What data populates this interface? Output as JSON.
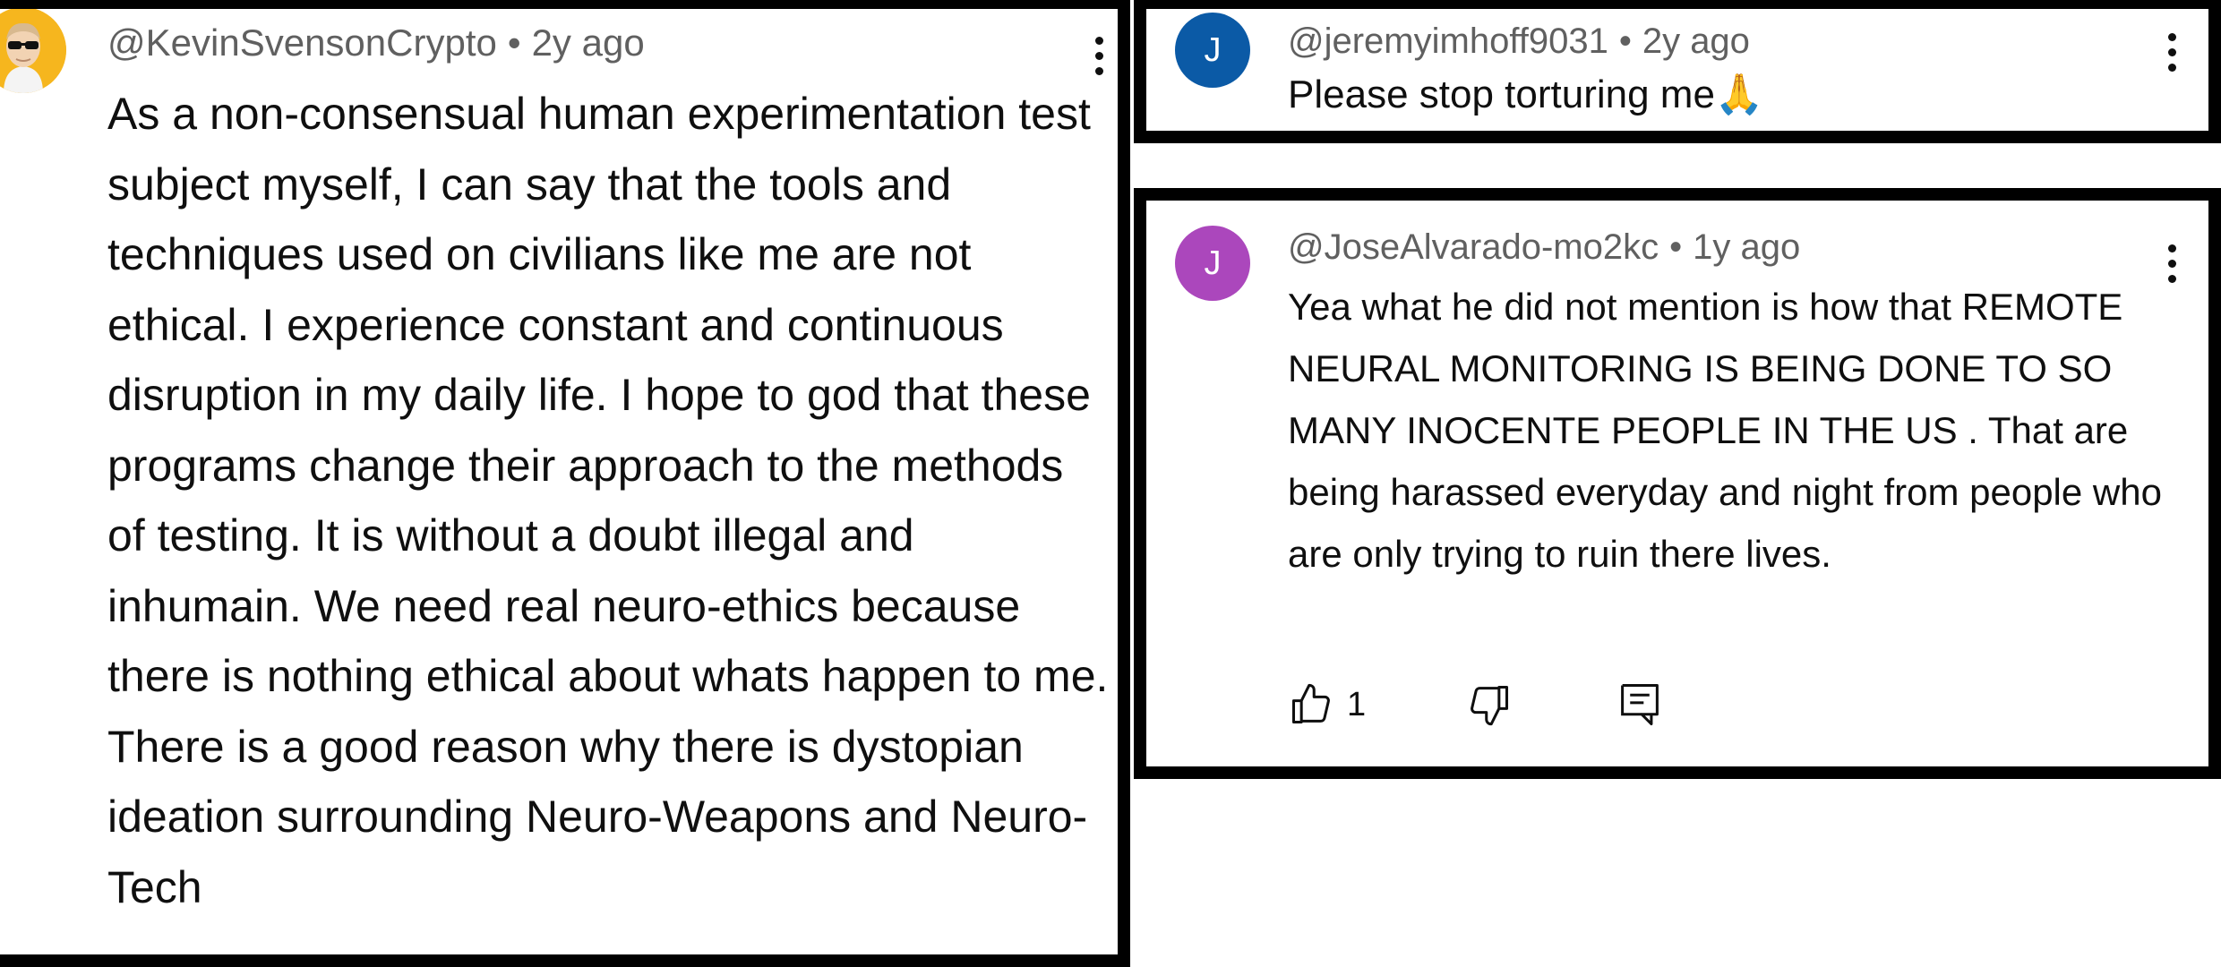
{
  "comments": [
    {
      "handle": "@KevinSvensonCrypto",
      "separator": "•",
      "time": "2y ago",
      "text": "As a non-consensual human experimentation test subject myself, I can say that the tools and techniques used on civilians like me are not ethical. I experience constant and continuous disruption in my daily life. I hope to god that these programs change their approach to the methods of testing. It is without a doubt illegal and inhumain. We need real neuro-ethics because there is nothing ethical about whats happen to me. There is a good reason why there is dystopian ideation surrounding Neuro-Weapons and Neuro-Tech",
      "avatar_icon": "cartoon-avatar-sunglasses",
      "avatar_color": "#f6b61e"
    },
    {
      "handle": "@jeremyimhoff9031",
      "separator": "•",
      "time": "2y ago",
      "text": "Please stop torturing me🙏",
      "avatar_letter": "J",
      "avatar_color": "#0b5aa6"
    },
    {
      "handle": "@JoseAlvarado-mo2kc",
      "separator": "•",
      "time": "1y ago",
      "text": "Yea what he did not mention is how that REMOTE NEURAL MONITORING IS BEING DONE TO SO MANY INOCENTE PEOPLE IN THE US . That are being harassed everyday and night from people who are only trying to ruin there lives.",
      "avatar_letter": "J",
      "avatar_color": "#ab47bc",
      "likes": "1",
      "actions": [
        "thumbs-up-icon",
        "thumbs-down-icon",
        "reply-icon"
      ]
    }
  ],
  "menu_icon": "more-vertical-icon"
}
